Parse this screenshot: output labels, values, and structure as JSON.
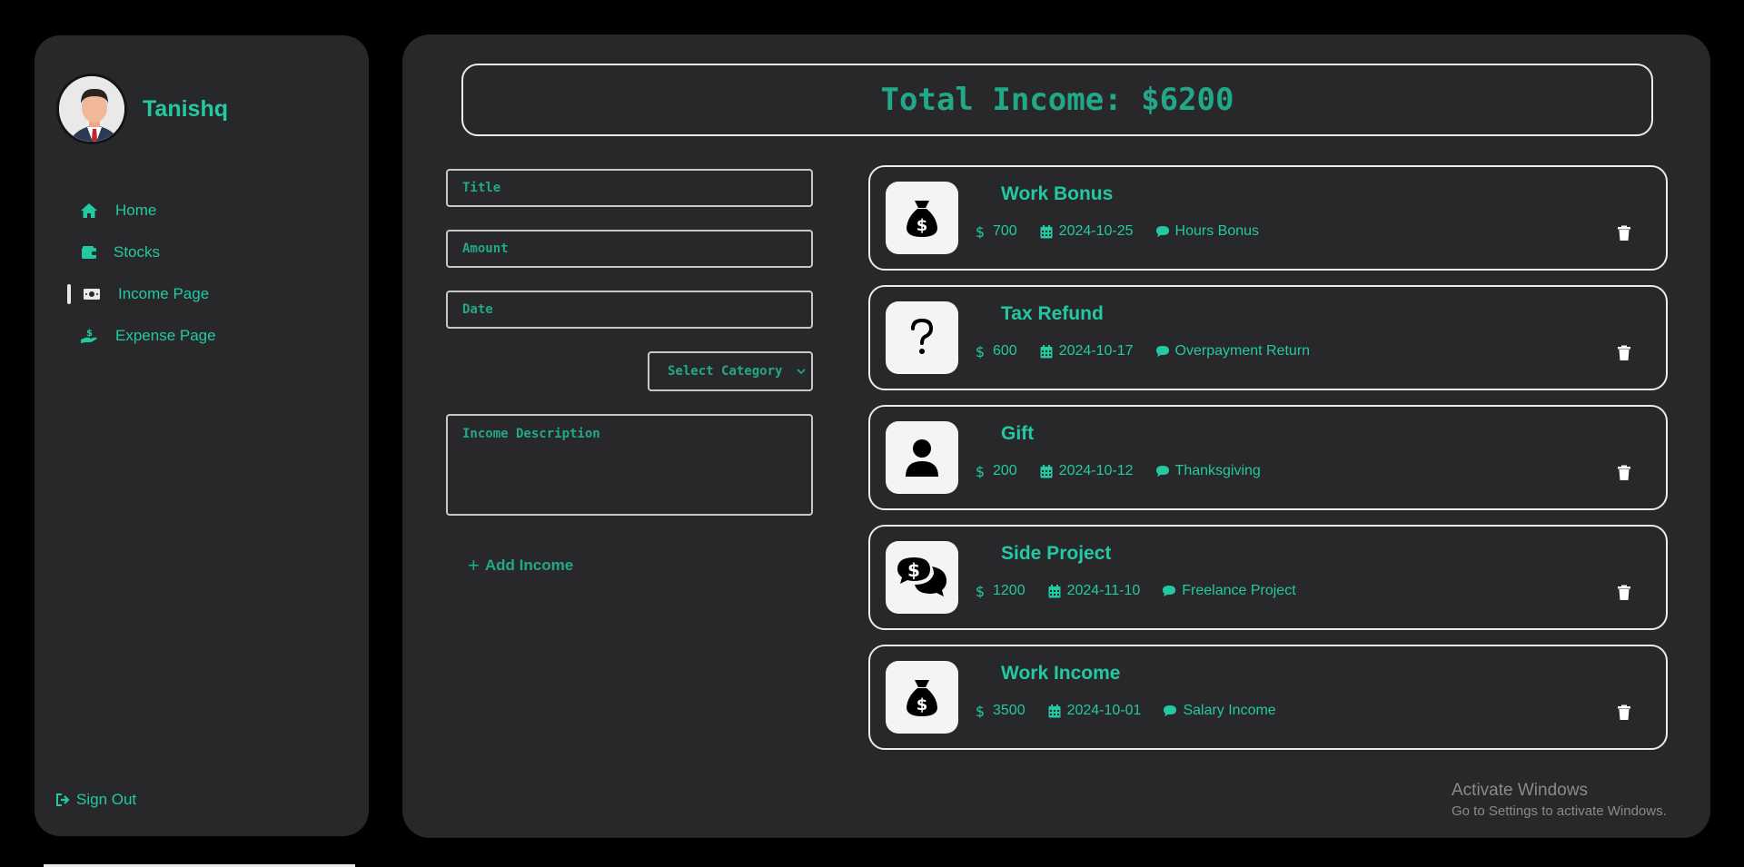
{
  "profile": {
    "name": "Tanishq"
  },
  "nav": {
    "items": [
      {
        "label": "Home",
        "icon": "home-icon"
      },
      {
        "label": "Stocks",
        "icon": "wallet-icon"
      },
      {
        "label": "Income Page",
        "icon": "money-bill-icon",
        "active": true
      },
      {
        "label": "Expense Page",
        "icon": "hand-holding-dollar-icon"
      }
    ],
    "sign_out": "Sign Out"
  },
  "total": {
    "label": "Total Income: $6200"
  },
  "form": {
    "title_placeholder": "Title",
    "amount_placeholder": "Amount",
    "date_placeholder": "Date",
    "category_placeholder": "Select Category",
    "description_placeholder": "Income Description",
    "add_button": "Add Income"
  },
  "incomes": [
    {
      "title": "Work Bonus",
      "amount": "700",
      "date": "2024-10-25",
      "note": "Hours Bonus",
      "icon": "money-bag-icon"
    },
    {
      "title": "Tax Refund",
      "amount": "600",
      "date": "2024-10-17",
      "note": "Overpayment Return",
      "icon": "question-icon"
    },
    {
      "title": "Gift",
      "amount": "200",
      "date": "2024-10-12",
      "note": "Thanksgiving",
      "icon": "user-icon"
    },
    {
      "title": "Side Project",
      "amount": "1200",
      "date": "2024-11-10",
      "note": "Freelance Project",
      "icon": "comments-dollar-icon"
    },
    {
      "title": "Work Income",
      "amount": "3500",
      "date": "2024-10-01",
      "note": "Salary Income",
      "icon": "money-bag-icon"
    }
  ],
  "watermark": {
    "line1": "Activate Windows",
    "line2": "Go to Settings to activate Windows."
  },
  "colors": {
    "accent": "#22c9a3",
    "accent_dark": "#22a889",
    "panel": "#28282a",
    "background": "#000000"
  }
}
